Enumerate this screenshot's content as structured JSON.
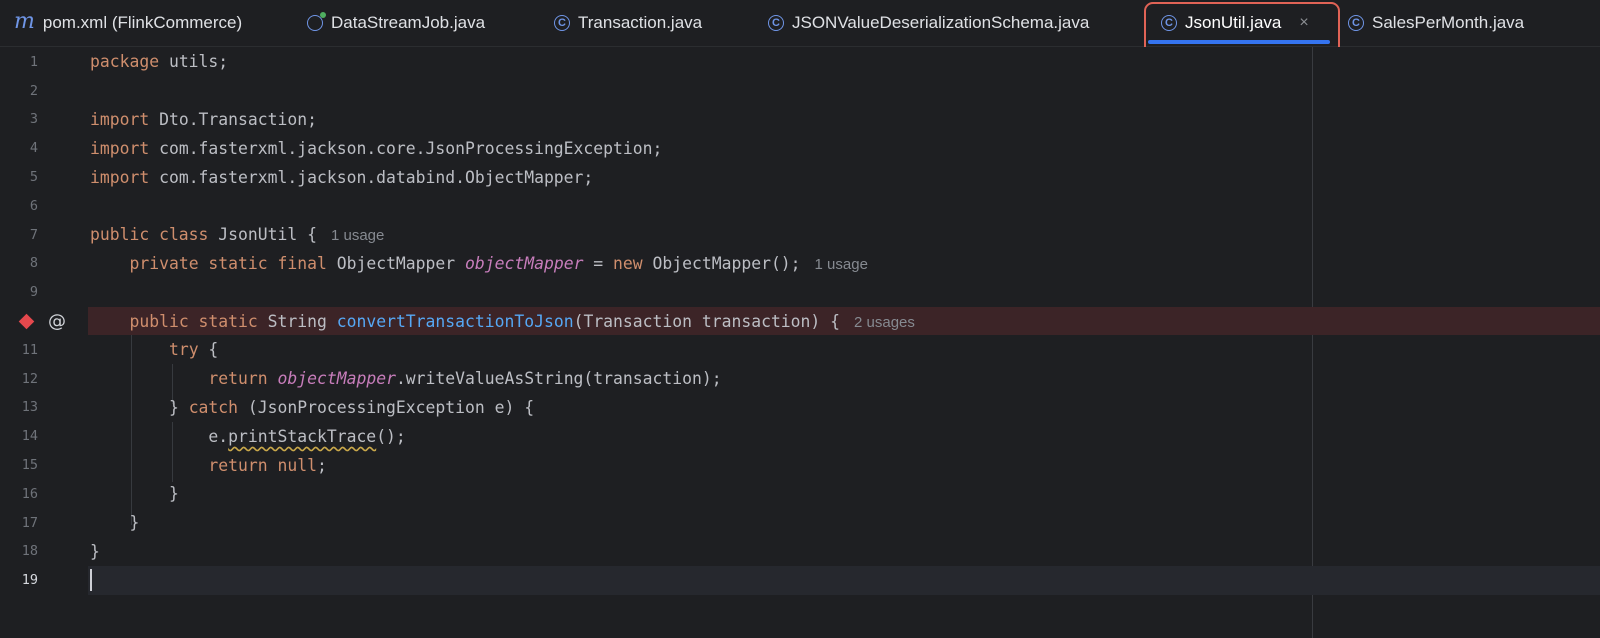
{
  "tabs": [
    {
      "label": "pom.xml (FlinkCommerce)",
      "icon": "maven-icon"
    },
    {
      "label": "DataStreamJob.java",
      "icon": "java-class-run-icon"
    },
    {
      "label": "Transaction.java",
      "icon": "java-class-icon"
    },
    {
      "label": "JSONValueDeserializationSchema.java",
      "icon": "java-class-icon"
    },
    {
      "label": "JsonUtil.java",
      "icon": "java-class-icon",
      "active": true,
      "close": "×"
    },
    {
      "label": "SalesPerMonth.java",
      "icon": "java-class-icon"
    }
  ],
  "icons": {
    "maven": "m",
    "class": "C",
    "breakpoint": "◆",
    "override": "@"
  },
  "lines": [
    {
      "n": "1",
      "text": "package utils;"
    },
    {
      "n": "2",
      "text": ""
    },
    {
      "n": "3",
      "text": "import Dto.Transaction;"
    },
    {
      "n": "4",
      "text": "import com.fasterxml.jackson.core.JsonProcessingException;"
    },
    {
      "n": "5",
      "text": "import com.fasterxml.jackson.databind.ObjectMapper;"
    },
    {
      "n": "6",
      "text": ""
    },
    {
      "n": "7",
      "text": "public class JsonUtil {",
      "hint": "1 usage"
    },
    {
      "n": "8",
      "text": "    private static final ObjectMapper objectMapper = new ObjectMapper();",
      "hint": "1 usage"
    },
    {
      "n": "9",
      "text": ""
    },
    {
      "n": "",
      "text": "    public static String convertTransactionToJson(Transaction transaction) {",
      "hint": "2 usages"
    },
    {
      "n": "11",
      "text": "        try {"
    },
    {
      "n": "12",
      "text": "            return objectMapper.writeValueAsString(transaction);"
    },
    {
      "n": "13",
      "text": "        } catch (JsonProcessingException e) {"
    },
    {
      "n": "14",
      "text": "            e.printStackTrace();"
    },
    {
      "n": "15",
      "text": "            return null;"
    },
    {
      "n": "16",
      "text": "        }"
    },
    {
      "n": "17",
      "text": "    }"
    },
    {
      "n": "18",
      "text": "}"
    },
    {
      "n": "19",
      "text": ""
    }
  ],
  "colors": {
    "keyword": "#cf8e6d",
    "method": "#56a8f5",
    "field": "#c77dbb",
    "breakpoint_line": "#3c2427",
    "tab_accent": "#3574f0",
    "highlight": "#e06356"
  }
}
